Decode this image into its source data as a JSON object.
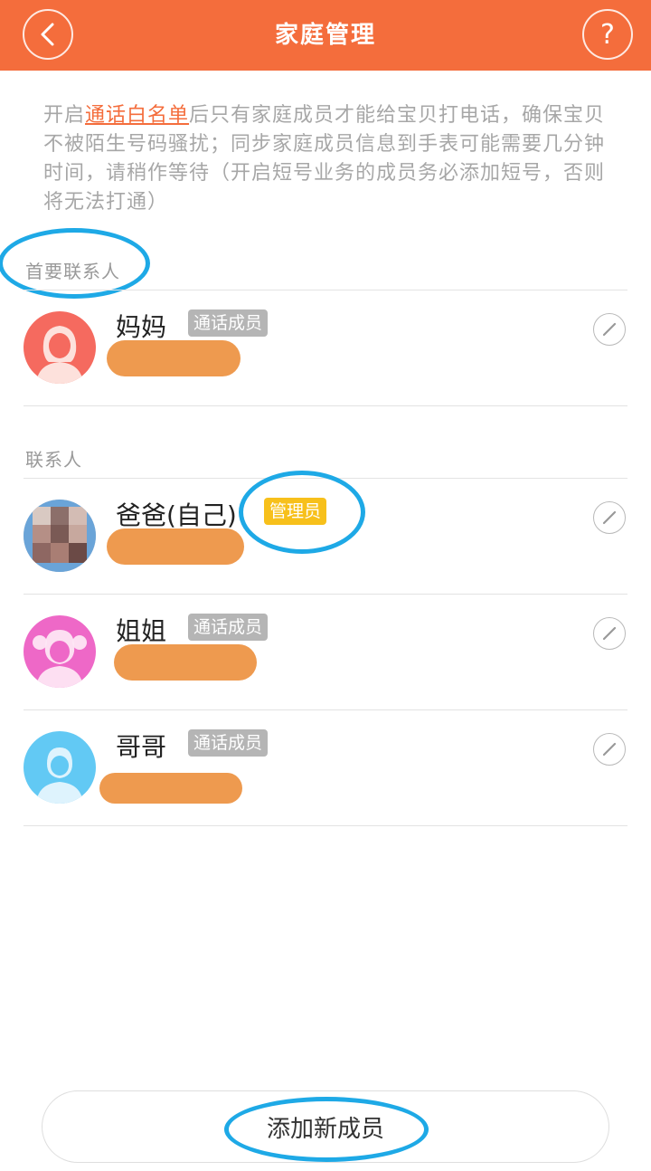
{
  "header": {
    "title": "家庭管理",
    "back_icon": "chevron-left-icon",
    "help_label": "?"
  },
  "notice": {
    "prefix": "开启",
    "link": "通话白名单",
    "rest": "后只有家庭成员才能给宝贝打电话，确保宝贝不被陌生号码骚扰；同步家庭成员信息到手表可能需要几分钟时间，请稍作等待（开启短号业务的成员务必添加短号，否则将无法打通）"
  },
  "primary_section": {
    "label": "首要联系人",
    "members": [
      {
        "name": "妈妈",
        "badge": "通话成员",
        "avatar": "mother-avatar-icon",
        "avatar_color": "#f56a5f"
      }
    ]
  },
  "contacts_section": {
    "label": "联系人",
    "members": [
      {
        "name": "爸爸(自己)",
        "badge": "管理员",
        "avatar": "father-photo-avatar",
        "avatar_color": "#8a6a65"
      },
      {
        "name": "姐姐",
        "badge": "通话成员",
        "avatar": "sister-avatar-icon",
        "avatar_color": "#ee68c7"
      },
      {
        "name": "哥哥",
        "badge": "通话成员",
        "avatar": "brother-avatar-icon",
        "avatar_color": "#62c9f4"
      }
    ]
  },
  "add_button": {
    "label": "添加新成员"
  },
  "colors": {
    "brand": "#f46d3c",
    "admin_badge": "#f7c01b",
    "member_badge": "#b5b5b5",
    "annotation": "#1ea9e6"
  }
}
